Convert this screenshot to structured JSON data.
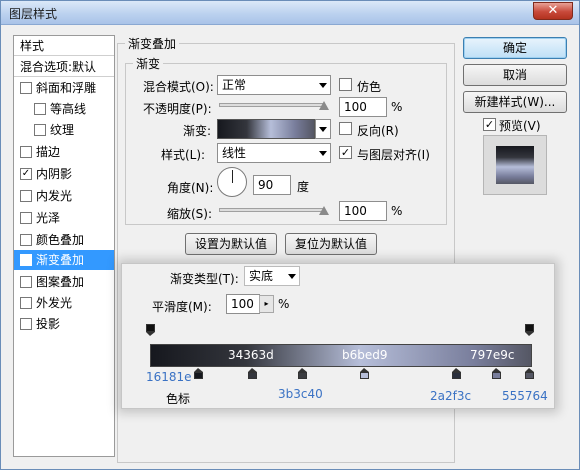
{
  "window": {
    "title": "图层样式",
    "close_glyph": "✕"
  },
  "left_list": {
    "items": [
      {
        "label": "样式",
        "checkbox": false,
        "checked": false,
        "indent": 0
      },
      {
        "label": "混合选项:默认",
        "checkbox": false,
        "checked": false,
        "indent": 0
      },
      {
        "label": "斜面和浮雕",
        "checkbox": true,
        "checked": false,
        "indent": 0
      },
      {
        "label": "等高线",
        "checkbox": true,
        "checked": false,
        "indent": 1
      },
      {
        "label": "纹理",
        "checkbox": true,
        "checked": false,
        "indent": 1
      },
      {
        "label": "描边",
        "checkbox": true,
        "checked": false,
        "indent": 0
      },
      {
        "label": "内阴影",
        "checkbox": true,
        "checked": true,
        "indent": 0
      },
      {
        "label": "内发光",
        "checkbox": true,
        "checked": false,
        "indent": 0
      },
      {
        "label": "光泽",
        "checkbox": true,
        "checked": false,
        "indent": 0
      },
      {
        "label": "颜色叠加",
        "checkbox": true,
        "checked": false,
        "indent": 0
      },
      {
        "label": "渐变叠加",
        "checkbox": true,
        "checked": true,
        "indent": 0,
        "selected": true
      },
      {
        "label": "图案叠加",
        "checkbox": true,
        "checked": false,
        "indent": 0
      },
      {
        "label": "外发光",
        "checkbox": true,
        "checked": false,
        "indent": 0
      },
      {
        "label": "投影",
        "checkbox": true,
        "checked": false,
        "indent": 0
      }
    ],
    "check_glyph": "✓"
  },
  "panel": {
    "group_title": "渐变叠加",
    "sub_title": "渐变",
    "blend_mode_label": "混合模式(O):",
    "blend_mode_value": "正常",
    "dither_label": "仿色",
    "opacity_label": "不透明度(P):",
    "opacity_value": "100",
    "opacity_level": 100,
    "percent": "%",
    "gradient_label": "渐变:",
    "reverse_label": "反向(R)",
    "style_label": "样式(L):",
    "style_value": "线性",
    "align_label": "与图层对齐(I)",
    "angle_label": "角度(N):",
    "angle_value": "90",
    "degree_unit": "度",
    "scale_label": "缩放(S):",
    "scale_value": "100",
    "scale_level": 100,
    "set_default": "设置为默认值",
    "reset_default": "复位为默认值"
  },
  "right_buttons": {
    "ok": "确定",
    "cancel": "取消",
    "new_style": "新建样式(W)...",
    "preview_label": "预览(V)"
  },
  "gradient_editor": {
    "type_label": "渐变类型(T):",
    "type_value": "实底",
    "smooth_label": "平滑度(M):",
    "smooth_value": "100",
    "percent": "%",
    "stepper_glyph": "▸",
    "color_stops_label": "色标",
    "colors": [
      "#16181e",
      "#34363d",
      "#b6bed9",
      "#797e9c",
      "#555764"
    ],
    "labels_inside": [
      "34363d",
      "b6bed9",
      "797e9c"
    ],
    "labels_outside": [
      "16181e",
      "3b3c40",
      "2a2f3c",
      "555764"
    ]
  }
}
